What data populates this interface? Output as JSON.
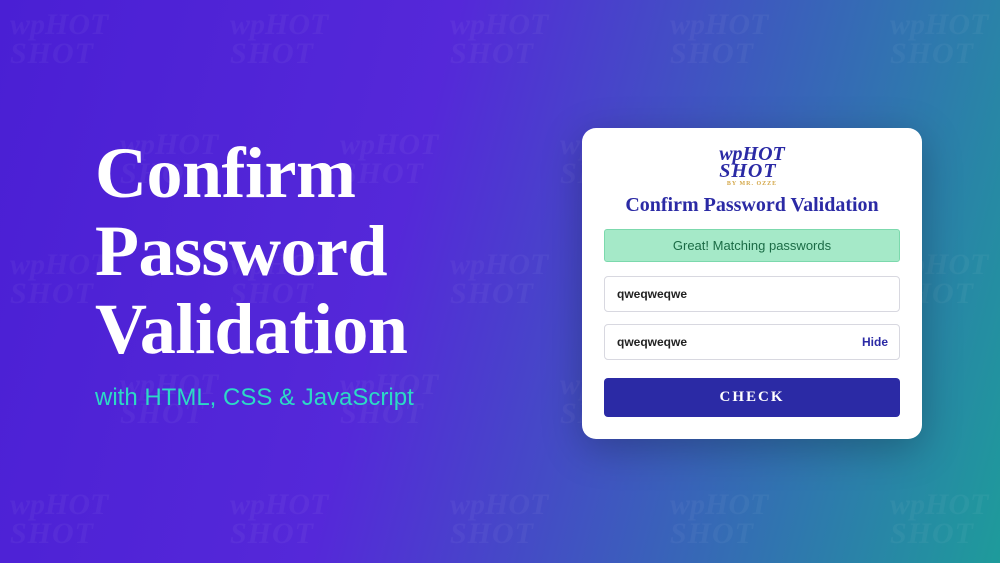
{
  "headline": {
    "title_line1": "Confirm",
    "title_line2": "Password",
    "title_line3": "Validation",
    "subtitle": "with HTML, CSS & JavaScript"
  },
  "card": {
    "logo_line1": "wpHOT",
    "logo_line2": "SHOT",
    "logo_sub": "BY MR. OZZE",
    "title": "Confirm Password Validation",
    "success_message": "Great! Matching passwords",
    "password_value": "qweqweqwe",
    "confirm_value": "qweqweqwe",
    "hide_toggle_label": "Hide",
    "check_button_label": "CHECK"
  },
  "colors": {
    "gradient_start": "#4a1fd4",
    "gradient_end": "#1e9b9b",
    "accent_teal": "#2dd9c5",
    "brand_blue": "#2b2aa5",
    "success_bg": "#a5e9c8",
    "success_text": "#1a6b45"
  }
}
